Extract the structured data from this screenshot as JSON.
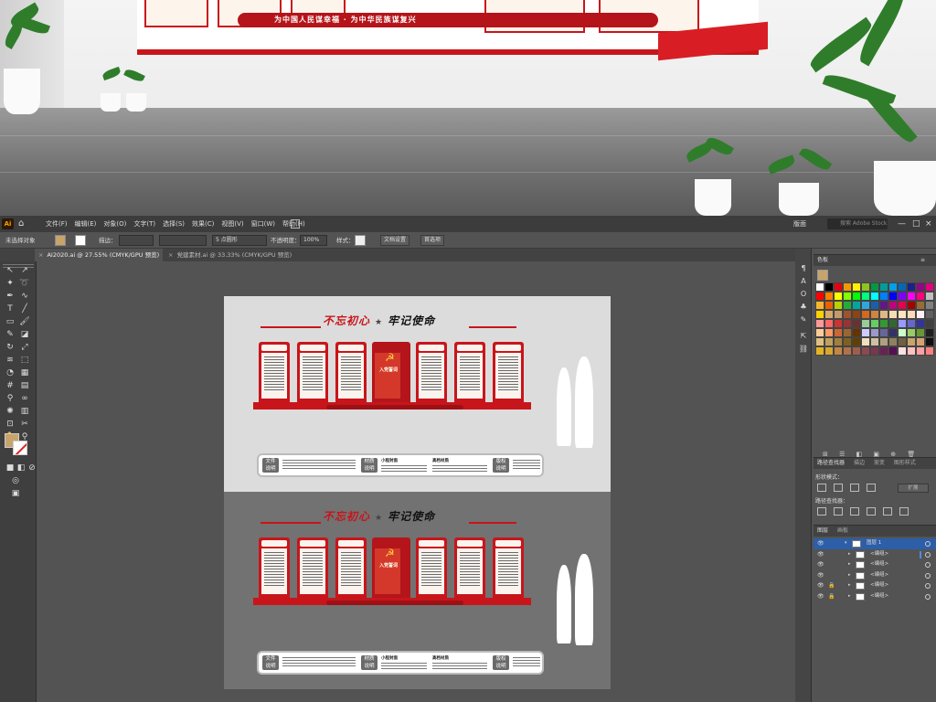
{
  "photo": {
    "ribbon_text": "为中国人民谋幸福 · 为中华民族谋复兴"
  },
  "menubar": {
    "app_logo": "Ai",
    "items": [
      "文件(F)",
      "编辑(E)",
      "对象(O)",
      "文字(T)",
      "选择(S)",
      "效果(C)",
      "视图(V)",
      "窗口(W)",
      "帮助(H)"
    ],
    "workspace": "版面",
    "search_placeholder": "搜索 Adobe Stock",
    "win_minimize": "—",
    "win_restore": "□",
    "win_close": "×"
  },
  "controlbar": {
    "selection": "未选择对象",
    "stroke_label": "描边：",
    "brush_label": "5 点圆形",
    "opacity_label": "不透明度：",
    "opacity_value": "100%",
    "style_label": "样式：",
    "doc_setup": "文档设置",
    "preferences": "首选项"
  },
  "tabs": [
    {
      "label": "AI2020.ai @ 27.55% (CMYK/GPU 预览)",
      "close": "×"
    },
    {
      "label": "党建素材.ai @ 33.33% (CMYK/GPU 预览)",
      "close": "×"
    }
  ],
  "artboard": {
    "title_left": "不忘初心",
    "title_star": "★",
    "title_right": "牢记使命",
    "center_caption": "入党誓词",
    "info_tags": [
      "文件\n说明",
      "材质\n说明",
      "版权\n说明"
    ],
    "info_subs": [
      "小程封面",
      "高档材质"
    ]
  },
  "panels": {
    "swatches_title": "色板",
    "pathfinder_tabs": [
      "路径查找器",
      "描边",
      "渐变",
      "图形样式"
    ],
    "shape_modes_label": "形状模式：",
    "pathfinders_label": "路径查找器：",
    "expand_btn": "扩展",
    "layers_tabs": [
      "图层",
      "画板"
    ],
    "layers": [
      {
        "name": "图层 1",
        "level": 0
      },
      {
        "name": "<编组>",
        "level": 1
      },
      {
        "name": "<编组>",
        "level": 1
      },
      {
        "name": "<编组>",
        "level": 1
      },
      {
        "name": "<编组>",
        "level": 1
      },
      {
        "name": "<编组>",
        "level": 1
      }
    ]
  },
  "colors": {
    "accent_red": "#c8151b",
    "fill_swatch": "#c8a36b",
    "layer_highlight": "#2d5ea8"
  },
  "swatches": [
    "#ffffff",
    "#000000",
    "#e60012",
    "#f39800",
    "#fff100",
    "#8fc31f",
    "#009944",
    "#009e96",
    "#00a0e9",
    "#0068b7",
    "#1d2088",
    "#920783",
    "#e4007f",
    "#ff0000",
    "#ff7f00",
    "#ffff00",
    "#7fff00",
    "#00ff00",
    "#00ff7f",
    "#00ffff",
    "#007fff",
    "#0000ff",
    "#7f00ff",
    "#ff00ff",
    "#ff007f",
    "#c0c0c0",
    "#f8b62d",
    "#eb6100",
    "#b8d200",
    "#22ac38",
    "#00a6a0",
    "#2ea7e0",
    "#1a5eab",
    "#601986",
    "#be0081",
    "#e5004f",
    "#a40000",
    "#996c33",
    "#808080",
    "#fdd000",
    "#d7a96b",
    "#c49a6c",
    "#a0522d",
    "#8b4513",
    "#d2691e",
    "#cd853f",
    "#deb887",
    "#f5deb3",
    "#ffe4c4",
    "#ffdab9",
    "#fff0f5",
    "#606060",
    "#ff9999",
    "#ff6666",
    "#cc3333",
    "#993333",
    "#663333",
    "#99cc99",
    "#66cc66",
    "#339933",
    "#336633",
    "#9999ff",
    "#6666cc",
    "#333399",
    "#404040",
    "#ffcc99",
    "#ff9966",
    "#cc6633",
    "#996633",
    "#663300",
    "#ccccff",
    "#9999cc",
    "#666699",
    "#333366",
    "#ccffcc",
    "#99cc66",
    "#669933",
    "#202020",
    "#e0c080",
    "#c0a060",
    "#a08040",
    "#806020",
    "#604000",
    "#f0e0c0",
    "#d0c0a0",
    "#b0a080",
    "#908060",
    "#706040",
    "#c8a36b",
    "#d4a373",
    "#101010",
    "#e6b422",
    "#d9a62e",
    "#c38743",
    "#b0724a",
    "#9e5e4c",
    "#8c4a4e",
    "#7a3650",
    "#682252",
    "#560e54",
    "#ffe0e0",
    "#ffc0c0",
    "#ffa0a0",
    "#ff8080"
  ]
}
